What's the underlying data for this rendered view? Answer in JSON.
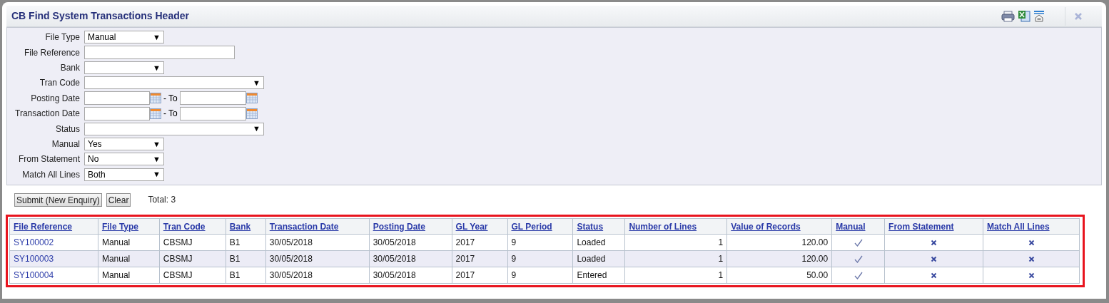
{
  "window": {
    "title": "CB Find System Transactions Header"
  },
  "form": {
    "fields": [
      {
        "label": "File Type",
        "kind": "select",
        "value": "Manual"
      },
      {
        "label": "File Reference",
        "kind": "text"
      },
      {
        "label": "Bank",
        "kind": "select"
      },
      {
        "label": "Tran Code",
        "kind": "long_select"
      },
      {
        "label": "Posting Date",
        "kind": "date_range",
        "to_label": "- To"
      },
      {
        "label": "Transaction Date",
        "kind": "date_range",
        "to_label": "- To"
      },
      {
        "label": "Status",
        "kind": "long_select"
      },
      {
        "label": "Manual",
        "kind": "select",
        "value": "Yes"
      },
      {
        "label": "From Statement",
        "kind": "select",
        "value": "No"
      },
      {
        "label": "Match All Lines",
        "kind": "select",
        "value": "Both"
      }
    ],
    "dropdown_glyph": "▼"
  },
  "actions": {
    "buttons": [
      "Submit (New Enquiry)",
      "Clear"
    ],
    "total": "Total: 3"
  },
  "table": {
    "columns": [
      "File Reference",
      "File Type",
      "Tran Code",
      "Bank",
      "Transaction Date",
      "Posting Date",
      "GL Year",
      "GL Period",
      "Status",
      "Number of Lines",
      "Value of Records",
      "Manual",
      "From Statement",
      "Match All Lines"
    ],
    "rows": [
      {
        "cells": [
          "SY100002",
          "Manual",
          "CBSMJ",
          "B1",
          "30/05/2018",
          "30/05/2018",
          "2017",
          "9",
          "Loaded",
          "1",
          "120.00"
        ],
        "flags": [
          true,
          false,
          false
        ]
      },
      {
        "cells": [
          "SY100003",
          "Manual",
          "CBSMJ",
          "B1",
          "30/05/2018",
          "30/05/2018",
          "2017",
          "9",
          "Loaded",
          "1",
          "120.00"
        ],
        "flags": [
          true,
          false,
          false
        ]
      },
      {
        "cells": [
          "SY100004",
          "Manual",
          "CBSMJ",
          "B1",
          "30/05/2018",
          "30/05/2018",
          "2017",
          "9",
          "Entered",
          "1",
          "50.00"
        ],
        "flags": [
          true,
          false,
          false
        ]
      }
    ]
  }
}
